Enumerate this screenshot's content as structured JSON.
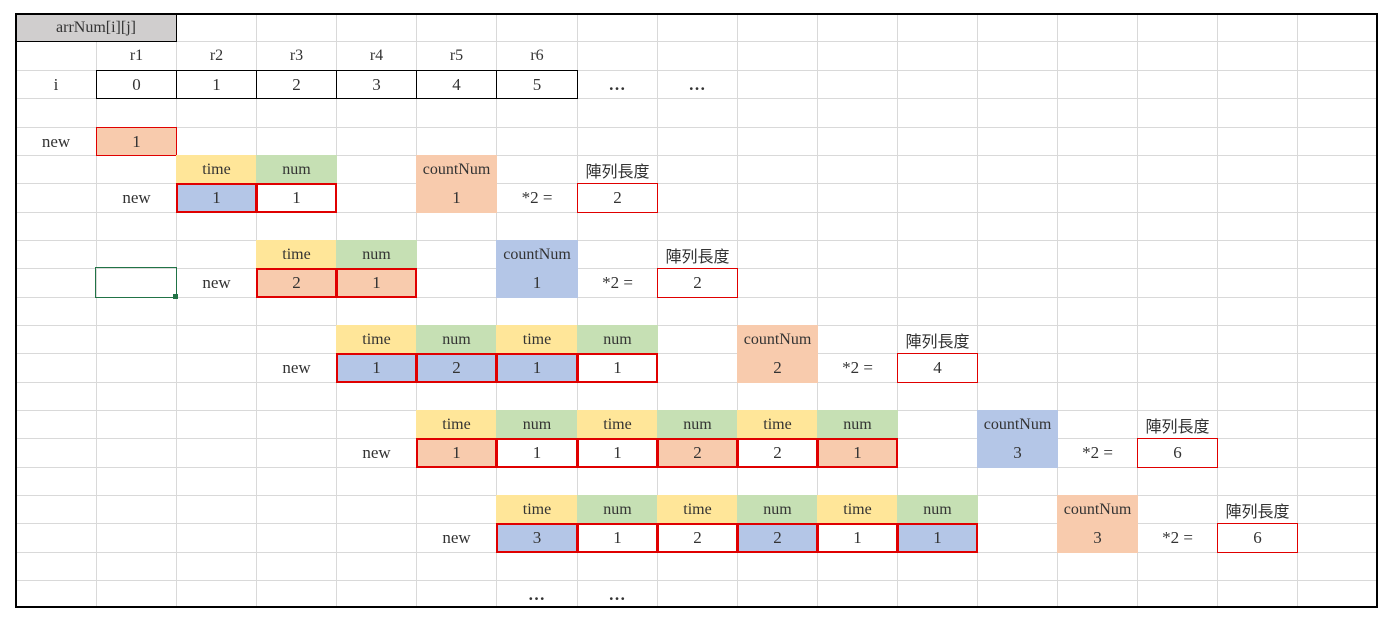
{
  "title_cell": "arrNum[i][j]",
  "row_headers": [
    "r1",
    "r2",
    "r3",
    "r4",
    "r5",
    "r6"
  ],
  "i_label": "i",
  "i_values": [
    "0",
    "1",
    "2",
    "3",
    "4",
    "5"
  ],
  "ellipsis": "…",
  "new_label": "new",
  "new_first_value": "1",
  "time_label": "time",
  "num_label": "num",
  "count_label": "countNum",
  "times_two": "*2 =",
  "length_label": "陣列長度",
  "colors": {
    "time_header": "#ffe699",
    "num_header": "#c6e0b4",
    "orange": "#f8cbad",
    "blue": "#b4c6e7",
    "title_fill": "#d0cece",
    "red_border": "#e00000"
  },
  "blocks": [
    {
      "values": [
        "1",
        "1"
      ],
      "fills": [
        "blue",
        "white"
      ],
      "count": "1",
      "count_fill": "orange",
      "length": "2"
    },
    {
      "values": [
        "2",
        "1"
      ],
      "fills": [
        "orange",
        "orange"
      ],
      "count": "1",
      "count_fill": "blue",
      "length": "2"
    },
    {
      "values": [
        "1",
        "2",
        "1",
        "1"
      ],
      "fills": [
        "blue",
        "blue",
        "blue",
        "white"
      ],
      "count": "2",
      "count_fill": "orange",
      "length": "4"
    },
    {
      "values": [
        "1",
        "1",
        "1",
        "2",
        "2",
        "1"
      ],
      "fills": [
        "orange",
        "white",
        "white",
        "orange",
        "white",
        "orange"
      ],
      "count": "3",
      "count_fill": "blue",
      "length": "6"
    },
    {
      "values": [
        "3",
        "1",
        "2",
        "2",
        "1",
        "1"
      ],
      "fills": [
        "blue",
        "white",
        "white",
        "blue",
        "white",
        "blue"
      ],
      "count": "3",
      "count_fill": "orange",
      "length": "6"
    }
  ]
}
